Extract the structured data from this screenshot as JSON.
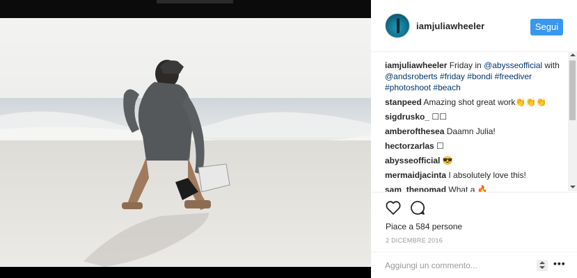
{
  "post": {
    "username": "iamjuliawheeler",
    "follow_label": "Segui",
    "caption": {
      "author": "iamjuliawheeler",
      "parts": [
        {
          "text": " Friday in ",
          "link": false
        },
        {
          "text": "@abysseofficial",
          "link": true
        },
        {
          "text": " with ",
          "link": false
        },
        {
          "text": "@andsroberts",
          "link": true
        },
        {
          "text": " ",
          "link": false
        },
        {
          "text": "#friday",
          "link": true
        },
        {
          "text": " ",
          "link": false
        },
        {
          "text": "#bondi",
          "link": true
        },
        {
          "text": " ",
          "link": false
        },
        {
          "text": "#freediver",
          "link": true
        },
        {
          "text": " ",
          "link": false
        },
        {
          "text": "#photoshoot",
          "link": true
        },
        {
          "text": " ",
          "link": false
        },
        {
          "text": "#beach",
          "link": true
        }
      ]
    },
    "comments": [
      {
        "author": "stanpeed",
        "text": " Amazing shot great work👏👏👏"
      },
      {
        "author": "sigdrusko_",
        "text": " ☐☐"
      },
      {
        "author": "amberofthesea",
        "text": " Daamn Julia!"
      },
      {
        "author": "hectorzarlas",
        "text": " ☐"
      },
      {
        "author": "abysseofficial",
        "text": " 😎"
      },
      {
        "author": "mermaidjacinta",
        "text": " I absolutely love this!"
      },
      {
        "author": "sam_thenomad",
        "text": " What a 🔥"
      }
    ],
    "likes_text": "Piace a 584 persone",
    "date": "2 DICEMBRE 2016",
    "comment_placeholder": "Aggiungi un commento...",
    "more_label": "•••"
  },
  "icons": {
    "like": "heart-icon",
    "comment": "comment-bubble-icon",
    "sort": "sort-arrows-icon",
    "more": "more-options-icon"
  },
  "colors": {
    "follow_button": "#3897f0",
    "link": "#003569",
    "text": "#262626",
    "muted": "#999999"
  }
}
